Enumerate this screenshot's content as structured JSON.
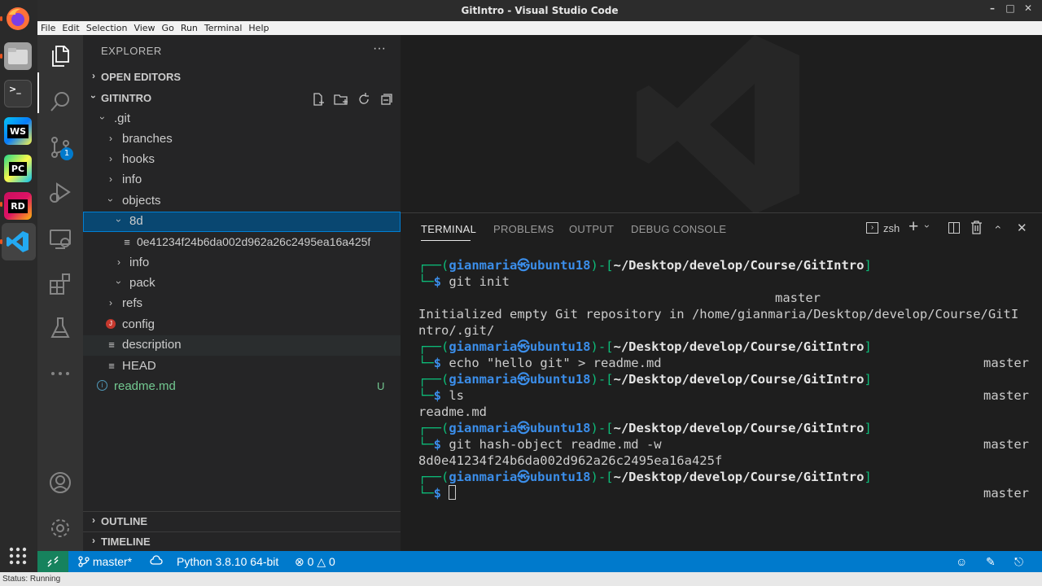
{
  "window": {
    "title": "GitIntro - Visual Studio Code"
  },
  "menu": [
    "File",
    "Edit",
    "Selection",
    "View",
    "Go",
    "Run",
    "Terminal",
    "Help"
  ],
  "dock": {
    "items": [
      {
        "name": "firefox-icon",
        "label": ""
      },
      {
        "name": "files-icon",
        "label": ""
      },
      {
        "name": "terminal-app-icon",
        "label": ">_"
      },
      {
        "name": "webstorm-icon",
        "label": "WS"
      },
      {
        "name": "pycharm-icon",
        "label": "PC"
      },
      {
        "name": "rider-icon",
        "label": "RD"
      },
      {
        "name": "vscode-icon",
        "label": ""
      }
    ]
  },
  "activity": {
    "scm_badge": "1"
  },
  "sidebar": {
    "title": "EXPLORER",
    "more": "···",
    "sections": {
      "open_editors": "OPEN EDITORS",
      "gitintro": "GITINTRO",
      "outline": "OUTLINE",
      "timeline": "TIMELINE"
    },
    "tree": [
      {
        "name": ".git",
        "depth": 1,
        "chevron": "open"
      },
      {
        "name": "branches",
        "depth": 2,
        "chevron": "closed"
      },
      {
        "name": "hooks",
        "depth": 2,
        "chevron": "closed"
      },
      {
        "name": "info",
        "depth": 2,
        "chevron": "closed"
      },
      {
        "name": "objects",
        "depth": 2,
        "chevron": "open"
      },
      {
        "name": "8d",
        "depth": 3,
        "chevron": "open",
        "selected": true
      },
      {
        "name": "0e41234f24b6da002d962a26c2495ea16a425f",
        "depth": 4,
        "chevron": "none",
        "icon": "lines"
      },
      {
        "name": "info",
        "depth": 3,
        "chevron": "closed"
      },
      {
        "name": "pack",
        "depth": 3,
        "chevron": "open"
      },
      {
        "name": "refs",
        "depth": 2,
        "chevron": "closed"
      },
      {
        "name": "config",
        "depth": 2,
        "chevron": "none",
        "icon": "red"
      },
      {
        "name": "description",
        "depth": 2,
        "chevron": "none",
        "icon": "lines",
        "hover": true
      },
      {
        "name": "HEAD",
        "depth": 2,
        "chevron": "none",
        "icon": "lines"
      },
      {
        "name": "readme.md",
        "depth": 1,
        "chevron": "none",
        "icon": "info",
        "status": "U"
      }
    ]
  },
  "panel": {
    "tabs": [
      "TERMINAL",
      "PROBLEMS",
      "OUTPUT",
      "DEBUG CONSOLE"
    ],
    "shell": "zsh",
    "user": "gianmaria",
    "host": "ubuntu18",
    "cwd": "~/Desktop/develop/Course/GitIntro",
    "branch": "master",
    "commands": [
      "git init",
      "echo \"hello git\" > readme.md",
      "ls",
      "git hash-object readme.md -w"
    ],
    "outputs": {
      "init_1": "Initialized empty Git repository in /home/gianmaria/Desktop/develop/Course/GitI",
      "init_2": "ntro/.git/",
      "ls": "readme.md",
      "hash": "8d0e41234f24b6da002d962a26c2495ea16a425f"
    }
  },
  "status": {
    "branch": "master*",
    "python": "Python 3.8.10 64-bit",
    "errors": "0",
    "warnings": "0"
  },
  "browser_status": "Status: Running"
}
